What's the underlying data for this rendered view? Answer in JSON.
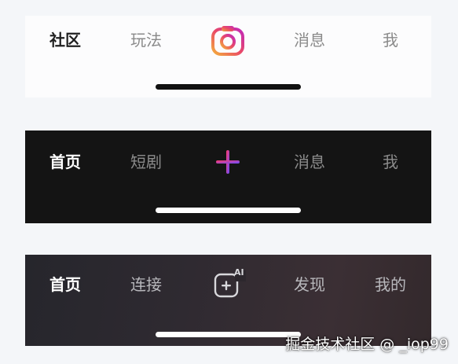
{
  "bar1": {
    "items": [
      "社区",
      "玩法",
      "消息",
      "我"
    ],
    "active_index": 0,
    "center_icon": "camera-icon",
    "accent_from": "#f3ad3c",
    "accent_mid": "#ea4a67",
    "accent_to": "#c229b8"
  },
  "bar2": {
    "items": [
      "首页",
      "短剧",
      "消息",
      "我"
    ],
    "active_index": 0,
    "center_icon": "plus-icon",
    "accent_from": "#ff3b6b",
    "accent_to": "#6a4cff"
  },
  "bar3": {
    "items": [
      "首页",
      "连接",
      "发现",
      "我的"
    ],
    "active_index": 0,
    "center_icon": "ai-add-icon",
    "center_badge": "AI"
  },
  "watermark": "掘金技术社区 @ _iop99"
}
